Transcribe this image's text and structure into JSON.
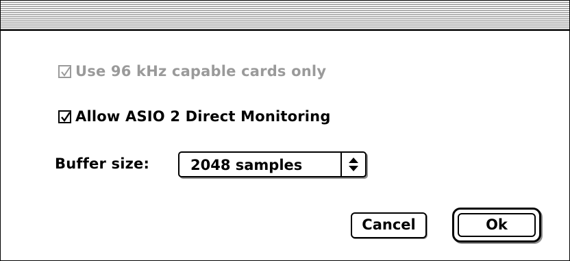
{
  "dialog": {
    "title": ""
  },
  "options": {
    "use_96khz": {
      "label": "Use 96 kHz capable cards only",
      "checked": true,
      "enabled": false
    },
    "asio2_monitoring": {
      "label": "Allow ASIO 2 Direct Monitoring",
      "checked": true,
      "enabled": true
    }
  },
  "buffer": {
    "label": "Buffer size:",
    "selected": "2048 samples"
  },
  "buttons": {
    "cancel": "Cancel",
    "ok": "Ok"
  },
  "colors": {
    "disabled_text": "#9a9a9a",
    "background": "#ffffff",
    "titlebar_stripes": "#8a8a8a"
  },
  "icons": {
    "checkmark": "checkmark-icon",
    "popup_arrows": "up-down-arrows-icon"
  }
}
